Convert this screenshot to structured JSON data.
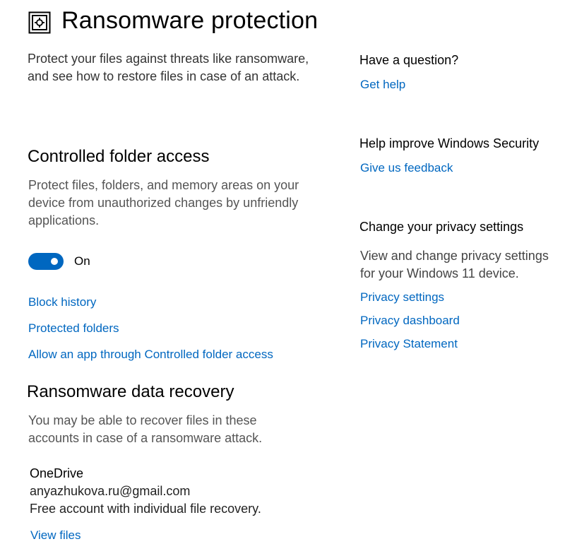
{
  "header": {
    "icon": "ransomware-shield-safe-icon",
    "title": "Ransomware protection"
  },
  "intro": "Protect your files against threats like ransomware, and see how to restore files in case of an attack.",
  "controlled_folder_access": {
    "heading": "Controlled folder access",
    "description": "Protect files, folders, and memory areas on your device from unauthorized changes by unfriendly applications.",
    "toggle_state": "On",
    "toggle_on": true,
    "accent_color": "#0067c0",
    "links": {
      "block_history": "Block history",
      "protected_folders": "Protected folders",
      "allow_app": "Allow an app through Controlled folder access"
    }
  },
  "data_recovery": {
    "heading": "Ransomware data recovery",
    "description": "You may be able to recover files in these accounts in case of a ransomware attack.",
    "service": "OneDrive",
    "account": "anyazhukova.ru@gmail.com",
    "plan": "Free account with individual file recovery.",
    "view_files": "View files"
  },
  "sidebar": {
    "question_heading": "Have a question?",
    "get_help": "Get help",
    "improve_heading": "Help improve Windows Security",
    "feedback": "Give us feedback",
    "privacy_heading": "Change your privacy settings",
    "privacy_description": "View and change privacy settings for your Windows 11 device.",
    "privacy_settings": "Privacy settings",
    "privacy_dashboard": "Privacy dashboard",
    "privacy_statement": "Privacy Statement"
  }
}
